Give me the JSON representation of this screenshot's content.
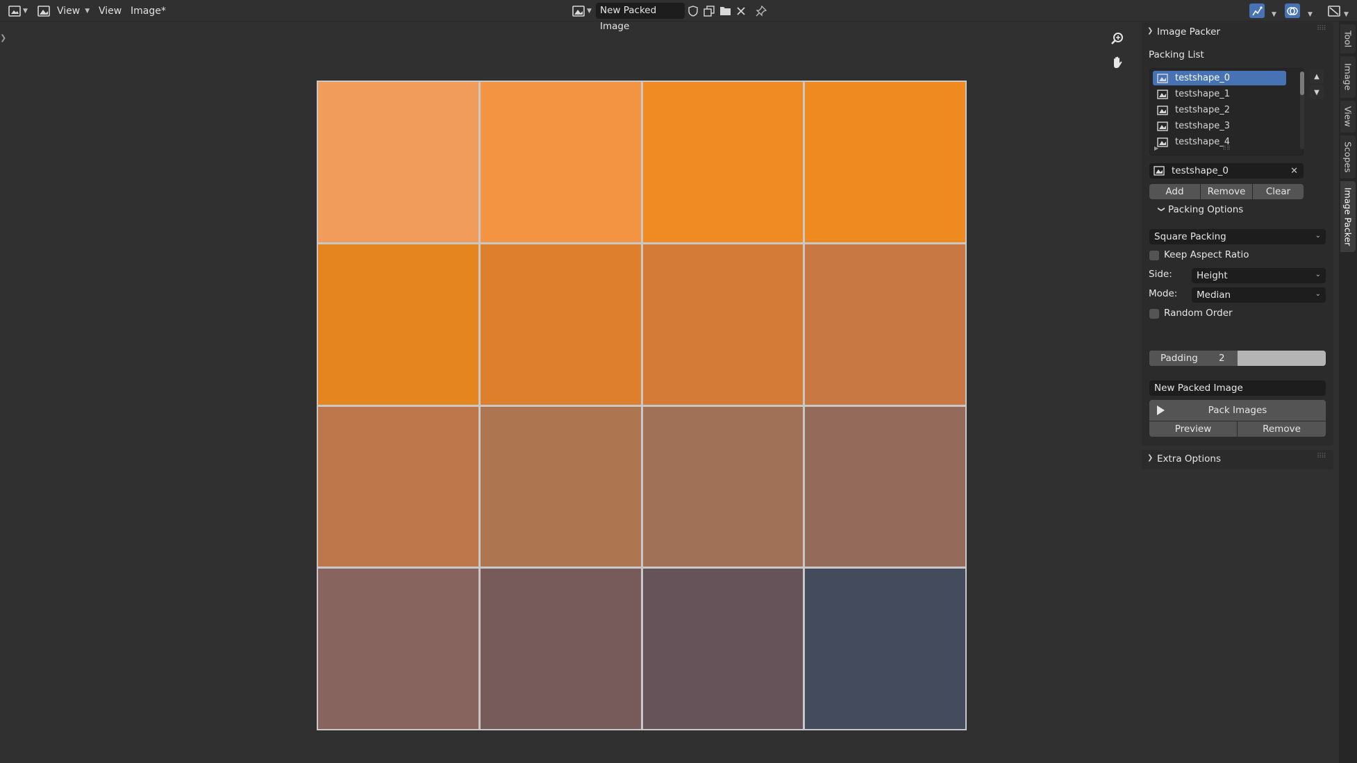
{
  "header": {
    "editor_type_icon": "image-editor-icon",
    "view_menu_label": "View",
    "menu_view": "View",
    "menu_image": "Image*",
    "image_name": "New Packed Image",
    "icons": [
      "fake-user-shield-icon",
      "duplicate-image-icon",
      "open-folder-icon",
      "close-icon",
      "pin-icon",
      "gizmo-toggle-icon",
      "overlay-toggle-icon",
      "display-mode-icon"
    ]
  },
  "canvas": {
    "grid_rows": 4,
    "grid_cols": 4,
    "tiles": [
      "#f29c5b",
      "#f29441",
      "#f08b24",
      "#ef8a20",
      "#e5851f",
      "#dd7f2c",
      "#d37b37",
      "#c87842",
      "#bd774a",
      "#ae7551",
      "#a07157",
      "#946a5b",
      "#87645e",
      "#775b5a",
      "#655359",
      "#434b5c"
    ],
    "tools": [
      "zoom-icon",
      "hand-pan-icon"
    ]
  },
  "panel": {
    "title": "Image Packer",
    "packing_list_label": "Packing List",
    "items": [
      {
        "label": "testshape_0",
        "active": true
      },
      {
        "label": "testshape_1",
        "active": false
      },
      {
        "label": "testshape_2",
        "active": false
      },
      {
        "label": "testshape_3",
        "active": false
      },
      {
        "label": "testshape_4",
        "active": false
      }
    ],
    "selected_image": "testshape_0",
    "buttons": {
      "add": "Add",
      "remove": "Remove",
      "clear": "Clear"
    },
    "packing_options_title": "Packing Options",
    "algorithm": "Square Packing",
    "keep_aspect_ratio": {
      "label": "Keep Aspect Ratio",
      "checked": false
    },
    "side": {
      "label": "Side:",
      "value": "Height"
    },
    "mode": {
      "label": "Mode:",
      "value": "Median"
    },
    "random_order": {
      "label": "Random Order",
      "checked": false
    },
    "padding": {
      "label": "Padding",
      "value": "2",
      "fraction": 0.5
    },
    "output_name": "New Packed Image",
    "pack_button": "Pack Images",
    "preview_button": "Preview",
    "remove_button": "Remove",
    "extra_options_title": "Extra Options"
  },
  "tabs": [
    {
      "label": "Tool",
      "active": false
    },
    {
      "label": "Image",
      "active": false
    },
    {
      "label": "View",
      "active": false
    },
    {
      "label": "Scopes",
      "active": false
    },
    {
      "label": "Image Packer",
      "active": true
    }
  ]
}
